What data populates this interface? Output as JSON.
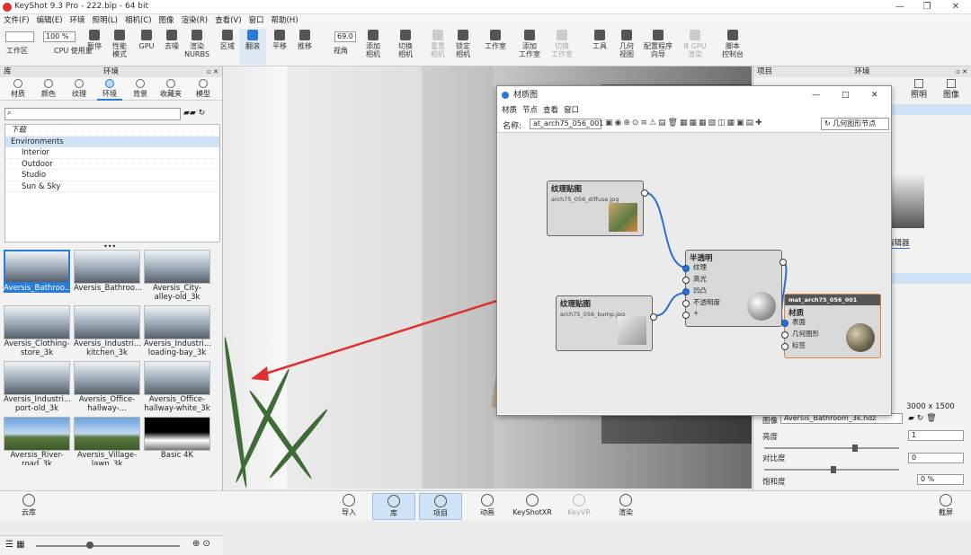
{
  "window": {
    "title": "KeyShot 9.3 Pro  - 222.bip  - 64 bit",
    "min": "—",
    "restore": "❐",
    "close": "✕"
  },
  "menu": [
    "文件(F)",
    "编辑(E)",
    "环境",
    "照明(L)",
    "相机(C)",
    "图像",
    "渲染(R)",
    "查看(V)",
    "窗口",
    "帮助(H)"
  ],
  "toolbar": {
    "dropdown1": "",
    "zoom": "100 %",
    "fov": "69.0",
    "buttons": [
      {
        "label": "工作区",
        "icon": "window-icon"
      },
      {
        "label": "CPU 使用量",
        "icon": "cpu-icon"
      },
      {
        "label": "暂停",
        "icon": "pause-icon"
      },
      {
        "label": "性能\n模式",
        "icon": "gauge-icon"
      },
      {
        "label": "GPU",
        "icon": "gpu-icon"
      },
      {
        "label": "去噪",
        "icon": "denoise-icon"
      },
      {
        "label": "渲染\nNURBS",
        "icon": "nurbs-icon"
      },
      {
        "label": "区域",
        "icon": "region-icon"
      },
      {
        "label": "翻滚",
        "icon": "tumble-icon"
      },
      {
        "label": "平移",
        "icon": "pan-icon"
      },
      {
        "label": "推移",
        "icon": "dolly-icon"
      },
      {
        "label": "视角",
        "icon": "fov-icon"
      },
      {
        "label": "添加\n相机",
        "icon": "add-camera-icon"
      },
      {
        "label": "切换\n相机",
        "icon": "switch-camera-icon"
      },
      {
        "label": "重置\n相机",
        "icon": "reset-camera-icon"
      },
      {
        "label": "锁定\n相机",
        "icon": "lock-camera-icon"
      },
      {
        "label": "工作室",
        "icon": "studio-icon"
      },
      {
        "label": "添加\n工作室",
        "icon": "add-studio-icon"
      },
      {
        "label": "切换\n工作室",
        "icon": "switch-studio-icon"
      },
      {
        "label": "工具",
        "icon": "tools-icon"
      },
      {
        "label": "几何\n视图",
        "icon": "geometry-view-icon"
      },
      {
        "label": "配置程序\n向导",
        "icon": "configurator-icon"
      },
      {
        "label": "Ⅲ GPU\n渲染",
        "icon": "gpu-render-icon"
      },
      {
        "label": "脚本\n控制台",
        "icon": "script-icon"
      }
    ]
  },
  "library": {
    "header": "环境",
    "left": "库",
    "tabs": [
      "材质",
      "颜色",
      "纹理",
      "环境",
      "背景",
      "收藏夹",
      "模型"
    ],
    "tree": [
      "下载",
      "Environments",
      "Interior",
      "Outdoor",
      "Studio",
      "Sun & Sky"
    ],
    "thumbs": [
      "Aversis_Bathroo...",
      "Aversis_Bathroo...",
      "Aversis_City-\nalley-old_3k",
      "Aversis_Clothing-\nstore_3k",
      "Aversis_Industri...\nkitchen_3k",
      "Aversis_Industri...\nloading-bay_3k",
      "Aversis_Industri...\nport-old_3k",
      "Aversis_Office-\nhallway-...",
      "Aversis_Office-\nhallway-white_3k",
      "Aversis_River-\nroad_3k",
      "Aversis_Village-\nlawn_3k",
      "Basic 4K"
    ]
  },
  "project": {
    "header": "环境",
    "left": "项目",
    "tabs": [
      "照明",
      "图像"
    ],
    "editor": "编辑器",
    "resolution": "3000 x 1500",
    "image_label": "图像",
    "image_value": "Aversis_Bathroom_3k.hdz",
    "brightness_label": "亮度",
    "brightness": "1",
    "contrast_label": "对比度",
    "contrast": "0",
    "saturation_label": "饱和度",
    "saturation": "0 %"
  },
  "material_graph": {
    "title": "材质图",
    "menu": [
      "材质",
      "节点",
      "查看",
      "窗口"
    ],
    "name_label": "名称:",
    "name_value": "at_arch75_056_001",
    "geo_node": "几何图形节点",
    "node_tex1": {
      "title": "纹理贴图",
      "file": "arch75_056_diffuse.jpg"
    },
    "node_tex2": {
      "title": "纹理贴图",
      "file": "arch75_056_bump.jpg"
    },
    "node_translucent": {
      "title": "半透明",
      "ports": [
        "纹理",
        "高光",
        "凹凸",
        "不透明度",
        "+"
      ]
    },
    "node_material": {
      "name": "mat_arch75_056_001",
      "title": "材质",
      "ports": [
        "表面",
        "几何图形",
        "标签"
      ]
    }
  },
  "bottom": {
    "cloud": "云库",
    "items": [
      "导入",
      "库",
      "项目",
      "动画",
      "KeyShotXR",
      "KeyVR",
      "渲染"
    ],
    "screenshot": "截屏"
  },
  "colors": {
    "accent": "#2a7ad8",
    "arrow": "#e03030"
  }
}
